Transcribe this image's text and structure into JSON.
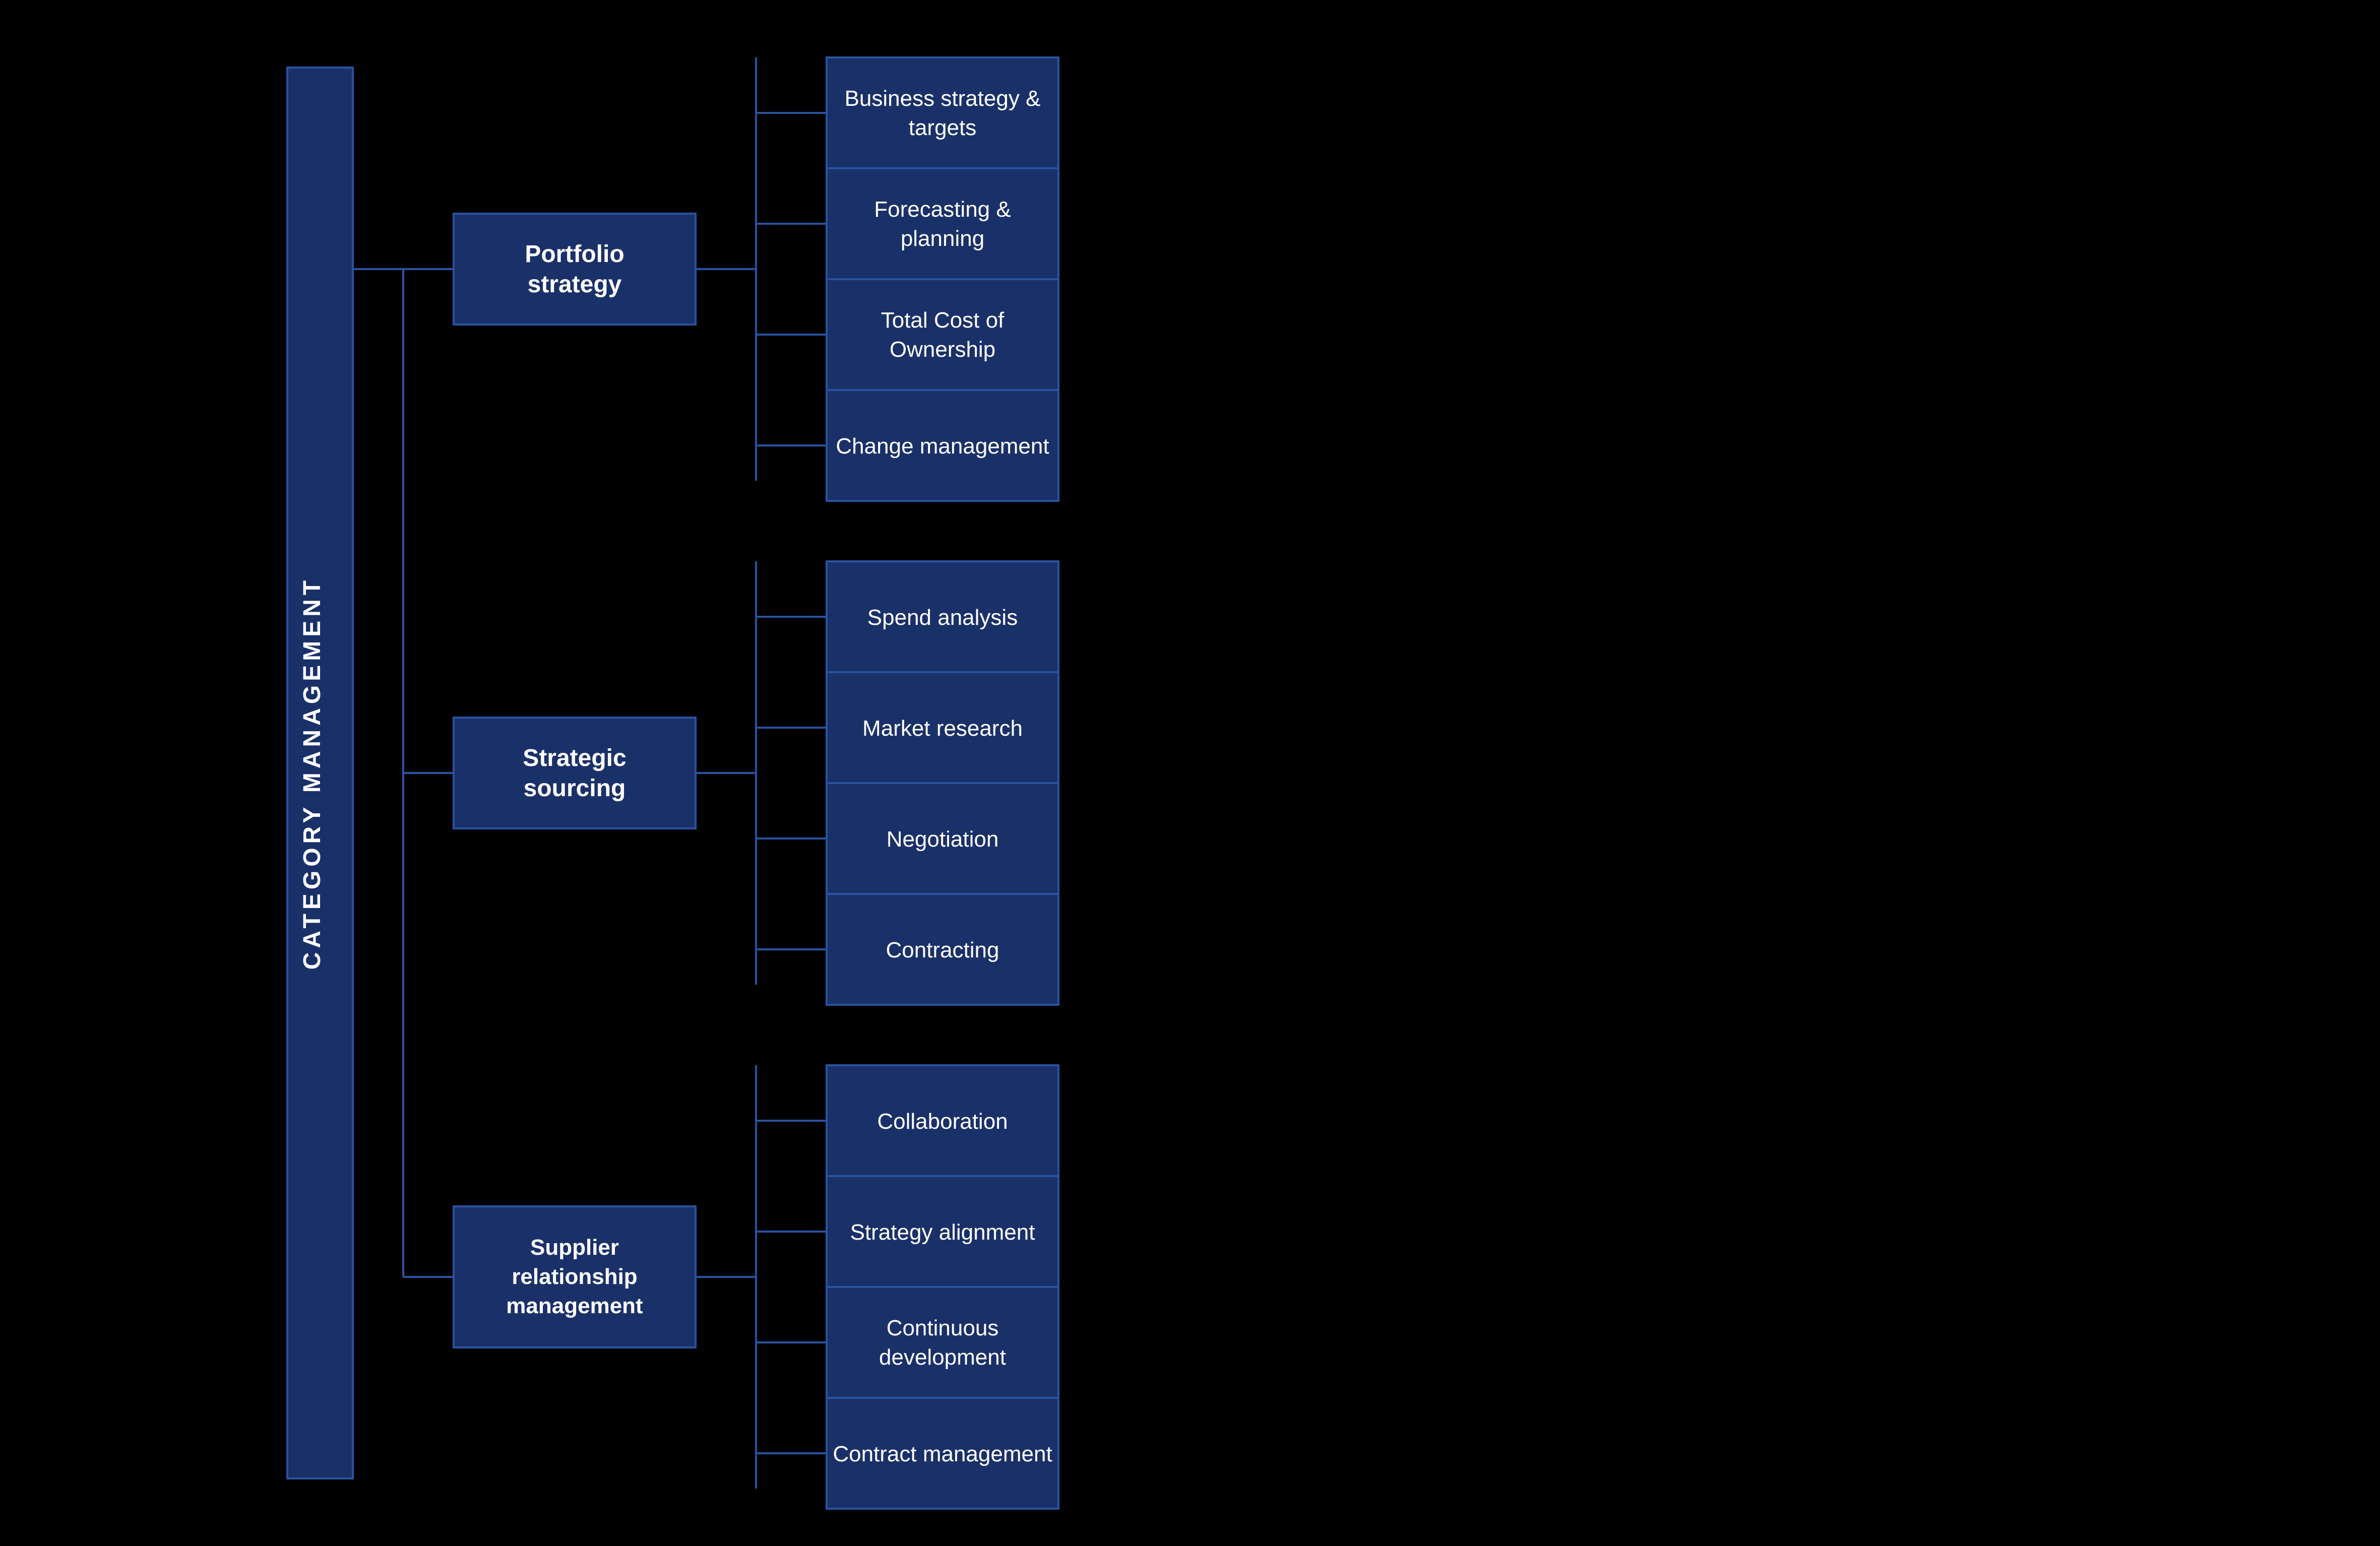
{
  "chart": {
    "root": "CATEGORY MANAGEMENT",
    "level1": [
      {
        "id": "portfolio-strategy",
        "label": "Portfolio strategy",
        "children": [
          "Business strategy & targets",
          "Forecasting & planning",
          "Total Cost of Ownership",
          "Change management"
        ]
      },
      {
        "id": "strategic-sourcing",
        "label": "Strategic sourcing",
        "children": [
          "Spend analysis",
          "Market research",
          "Negotiation",
          "Contracting"
        ]
      },
      {
        "id": "supplier-relationship",
        "label": "Supplier relationship management",
        "children": [
          "Collaboration",
          "Strategy alignment",
          "Continuous development",
          "Contract management"
        ]
      }
    ]
  },
  "colors": {
    "dark_navy": "#0d1f4e",
    "navy": "#1a3068",
    "border": "#2a52a0",
    "bg": "#000000"
  }
}
